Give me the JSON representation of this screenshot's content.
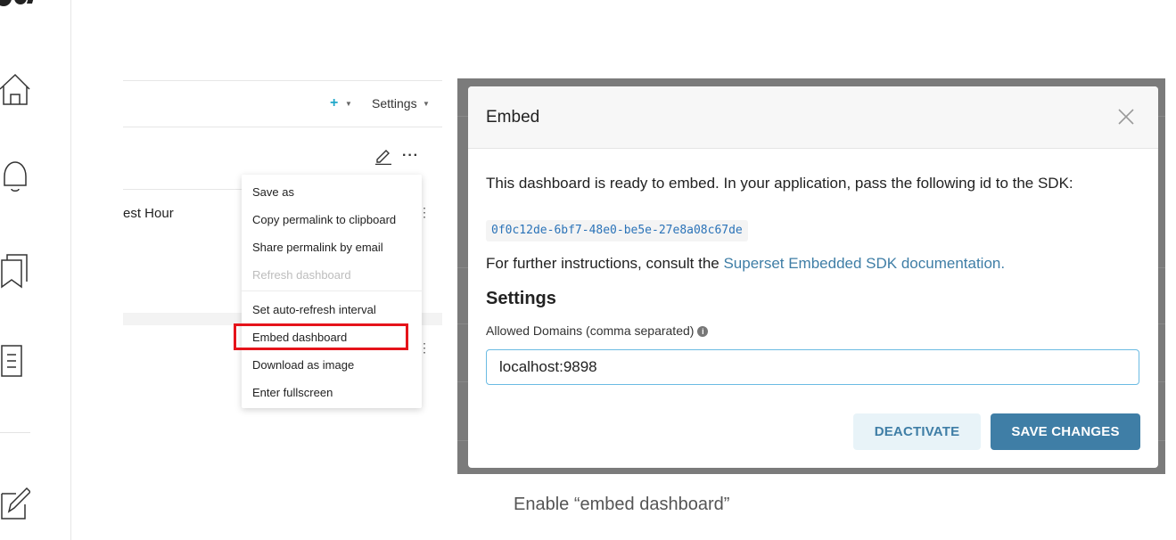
{
  "dashboard": {
    "add_label": "+",
    "settings_label": "Settings",
    "chart_title_fragment": "est Hour",
    "more_label": "···",
    "kebab": "⋮"
  },
  "menu": {
    "items": [
      {
        "label": "Save as"
      },
      {
        "label": "Copy permalink to clipboard"
      },
      {
        "label": "Share permalink by email"
      },
      {
        "label": "Refresh dashboard",
        "disabled": true
      },
      {
        "label": "Set auto-refresh interval"
      },
      {
        "label": "Embed dashboard",
        "highlighted": true
      },
      {
        "label": "Download as image"
      },
      {
        "label": "Enter fullscreen"
      }
    ]
  },
  "modal": {
    "title": "Embed",
    "intro": "This dashboard is ready to embed. In your application, pass the following id to the SDK:",
    "embed_id": "0f0c12de-6bf7-48e0-be5e-27e8a08c67de",
    "further_prefix": "For further instructions, consult the ",
    "further_link": "Superset Embedded SDK documentation.",
    "settings_heading": "Settings",
    "domains_label": "Allowed Domains (comma separated)",
    "domains_value": "localhost:9898",
    "deactivate_label": "DEACTIVATE",
    "save_label": "SAVE CHANGES"
  },
  "caption": "Enable “embed dashboard”",
  "colors": {
    "primary": "#3f7ea6",
    "highlight_border": "#e5131a",
    "overlay": "#7b7b7b"
  }
}
